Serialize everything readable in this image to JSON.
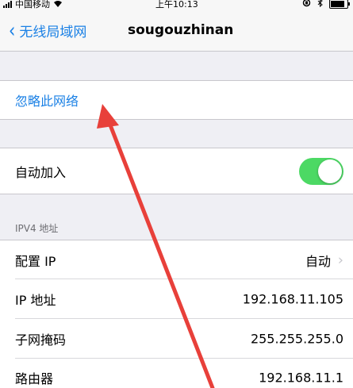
{
  "status_bar": {
    "carrier": "中国移动",
    "time": "上午10:13"
  },
  "nav": {
    "back_label": "无线局域网",
    "title": "sougouzhinan"
  },
  "forget_network": {
    "label": "忽略此网络"
  },
  "auto_join": {
    "label": "自动加入",
    "enabled": true
  },
  "ipv4": {
    "header": "IPV4 地址",
    "rows": [
      {
        "label": "配置 IP",
        "value": "自动"
      },
      {
        "label": "IP 地址",
        "value": "192.168.11.105"
      },
      {
        "label": "子网掩码",
        "value": "255.255.255.0"
      },
      {
        "label": "路由器",
        "value": "192.168.11.1"
      }
    ]
  },
  "colors": {
    "accent": "#1a80e5",
    "toggle_on": "#4cd964",
    "annotation_arrow": "#e8403a"
  }
}
